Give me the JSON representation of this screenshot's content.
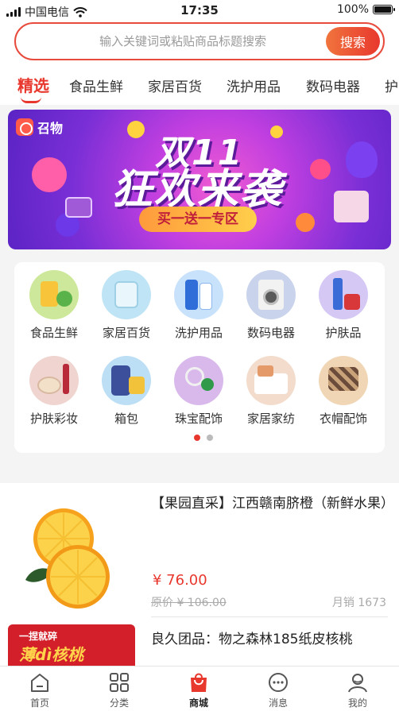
{
  "status_bar": {
    "carrier": "中国电信",
    "time": "17:35",
    "battery": "100%"
  },
  "search": {
    "placeholder": "输入关键词或粘贴商品标题搜索",
    "button_label": "搜索"
  },
  "tabs": [
    {
      "label": "精选",
      "active": true
    },
    {
      "label": "食品生鲜",
      "active": false
    },
    {
      "label": "家居百货",
      "active": false
    },
    {
      "label": "洗护用品",
      "active": false
    },
    {
      "label": "数码电器",
      "active": false
    },
    {
      "label": "护",
      "active": false
    }
  ],
  "banner": {
    "logo_text": "召物",
    "title_line1": "双11",
    "title_line2": "狂欢来袭",
    "subtitle": "买一送一专区"
  },
  "categories": [
    {
      "label": "食品生鲜",
      "icon": "food-icon",
      "color": "#cde89a"
    },
    {
      "label": "家居百货",
      "icon": "home-goods-icon",
      "color": "#bfe4f5"
    },
    {
      "label": "洗护用品",
      "icon": "wash-care-icon",
      "color": "#c9e2fb"
    },
    {
      "label": "数码电器",
      "icon": "appliance-icon",
      "color": "#c9d4ec"
    },
    {
      "label": "护肤品",
      "icon": "skincare-icon",
      "color": "#d6c8f5"
    },
    {
      "label": "护肤彩妆",
      "icon": "makeup-icon",
      "color": "#efd4cf"
    },
    {
      "label": "箱包",
      "icon": "luggage-icon",
      "color": "#bcdff5"
    },
    {
      "label": "珠宝配饰",
      "icon": "jewelry-icon",
      "color": "#d9b9ec"
    },
    {
      "label": "家居家纺",
      "icon": "bedding-icon",
      "color": "#f3dccb"
    },
    {
      "label": "衣帽配饰",
      "icon": "scarf-icon",
      "color": "#f1d6b6"
    }
  ],
  "pager": {
    "count": 2,
    "active": 0
  },
  "products": [
    {
      "title": "【果园直采】江西赣南脐橙（新鲜水果）",
      "price": "¥ 76.00",
      "original_price": "原价 ¥ 106.00",
      "sales": "月销 1673"
    },
    {
      "title": "良久团品：物之森林185纸皮核桃",
      "image_text_line1": "一捏就碎",
      "image_text_line2": "薄dì核桃"
    }
  ],
  "tabbar": [
    {
      "label": "首页",
      "icon": "home-icon",
      "active": false
    },
    {
      "label": "分类",
      "icon": "category-grid-icon",
      "active": false
    },
    {
      "label": "商城",
      "icon": "shopping-bag-icon",
      "active": true
    },
    {
      "label": "消息",
      "icon": "message-icon",
      "active": false
    },
    {
      "label": "我的",
      "icon": "profile-icon",
      "active": false
    }
  ],
  "colors": {
    "accent": "#e8382e",
    "search_gradient_start": "#f0743d",
    "banner_purple": "#7a2fd6"
  }
}
